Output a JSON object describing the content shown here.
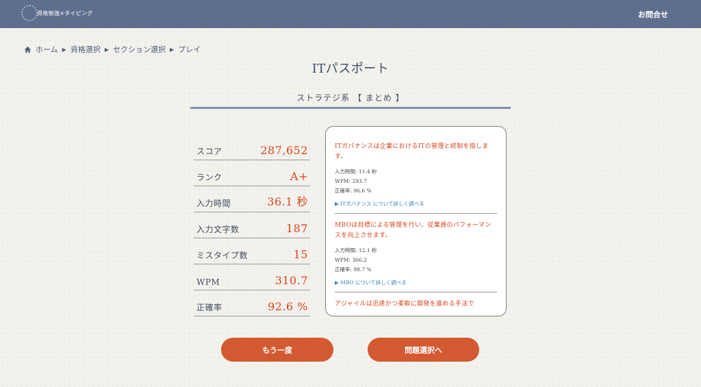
{
  "header": {
    "logo_text": "資格勉強×タイピング",
    "contact_label": "お問合せ"
  },
  "breadcrumb": {
    "items": [
      "ホーム",
      "資格選択",
      "セクション選択",
      "プレイ"
    ]
  },
  "title": "ITパスポート",
  "subtitle": "ストラテジ系 【 まとめ 】",
  "stats": [
    {
      "label": "スコア",
      "value": "287,652"
    },
    {
      "label": "ランク",
      "value": "A+"
    },
    {
      "label": "入力時間",
      "value": "36.1 秒"
    },
    {
      "label": "入力文字数",
      "value": "187"
    },
    {
      "label": "ミスタイプ数",
      "value": "15"
    },
    {
      "label": "WPM",
      "value": "310.7"
    },
    {
      "label": "正確率",
      "value": "92.6 %"
    }
  ],
  "entries": [
    {
      "description": "ITガバナンスは企業におけるITの管理と統制を指します。",
      "time": "入力時間: 11.4 秒",
      "wpm": "WPM: 293.7",
      "accuracy": "正確率: 96.6 %",
      "link": "▶ ITガバナンス について詳しく調べる"
    },
    {
      "description": "MBOは目標による管理を行い、従業員のパフォーマンスを向上させます。",
      "time": "入力時間: 12.1 秒",
      "wpm": "WPM: 366.2",
      "accuracy": "正確率: 98.7 %",
      "link": "▶ MBO について詳しく調べる"
    },
    {
      "description": "アジャイルは迅速かつ柔軟に開発を進める手法で"
    }
  ],
  "buttons": {
    "retry": "もう一度",
    "select": "問題選択へ"
  },
  "colors": {
    "header": "#5e6f8d",
    "accent": "#d9431d",
    "button": "#d35a30",
    "link": "#3a82c6"
  }
}
